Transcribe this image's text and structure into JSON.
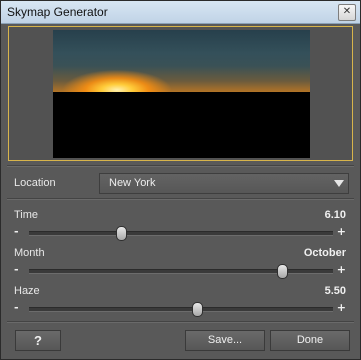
{
  "window": {
    "title": "Skymap Generator",
    "close_glyph": "✕"
  },
  "preview": {
    "description_icon": "sky-preview"
  },
  "location": {
    "label": "Location",
    "value": "New York"
  },
  "sliders": [
    {
      "label": "Time",
      "value": "6.10",
      "fraction": 0.3,
      "minus": "-",
      "plus": "+"
    },
    {
      "label": "Month",
      "value": "October",
      "fraction": 0.83,
      "minus": "-",
      "plus": "+"
    },
    {
      "label": "Haze",
      "value": "5.50",
      "fraction": 0.55,
      "minus": "-",
      "plus": "+"
    }
  ],
  "buttons": {
    "help": "?",
    "save": "Save...",
    "done": "Done"
  },
  "colors": {
    "accent_border": "#d7b44b",
    "panel_bg": "#595959"
  }
}
